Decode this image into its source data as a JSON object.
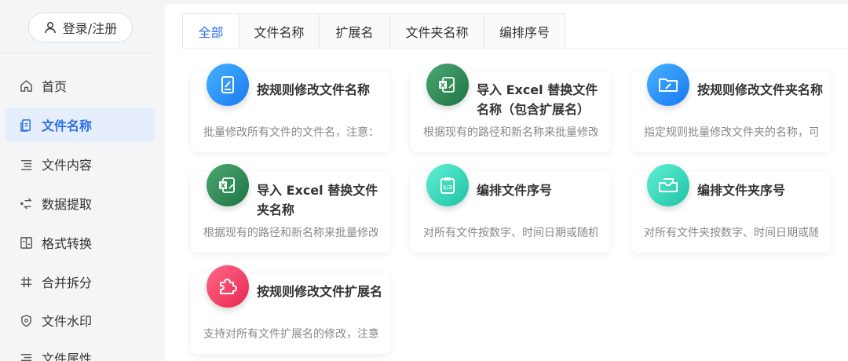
{
  "sidebar": {
    "login_label": "登录/注册",
    "items": [
      {
        "label": "首页",
        "icon": "home-icon"
      },
      {
        "label": "文件名称",
        "icon": "file-icon",
        "active": true
      },
      {
        "label": "文件内容",
        "icon": "list-icon"
      },
      {
        "label": "数据提取",
        "icon": "extract-icon"
      },
      {
        "label": "格式转换",
        "icon": "convert-icon"
      },
      {
        "label": "合并拆分",
        "icon": "hash-icon"
      },
      {
        "label": "文件水印",
        "icon": "shield-icon"
      },
      {
        "label": "文件属性",
        "icon": "list-icon"
      }
    ]
  },
  "tabs": [
    "全部",
    "文件名称",
    "扩展名",
    "文件夹名称",
    "编排序号"
  ],
  "active_tab": "全部",
  "cards": [
    {
      "title": "按规则修改文件名称",
      "desc": "批量修改所有文件的文件名，注意：i",
      "icon": "edit-file-icon",
      "color": "#2f8cf5"
    },
    {
      "title": "导入 Excel 替换文件名称（包含扩展名）",
      "desc": "根据现有的路径和新名称来批量修改,",
      "icon": "excel-icon",
      "color": "#2f8a55"
    },
    {
      "title": "按规则修改文件夹名称",
      "desc": "指定规则批量修改文件夹的名称，可以",
      "icon": "folder-edit-icon",
      "color": "#2f8cf5"
    },
    {
      "title": "导入 Excel 替换文件夹名称",
      "desc": "根据现有的路径和新名称来批量修改,",
      "icon": "excel-icon",
      "color": "#2f8a55"
    },
    {
      "title": "编排文件序号",
      "desc": "对所有文件按数字、时间日期或随机",
      "icon": "clipboard-icon",
      "color": "#2fd3b8"
    },
    {
      "title": "编排文件夹序号",
      "desc": "对所有文件夹按数字、时间日期或随机",
      "icon": "folder-tray-icon",
      "color": "#2fd3b8"
    },
    {
      "title": "按规则修改文件扩展名",
      "desc": "支持对所有文件扩展名的修改，注意:",
      "icon": "puzzle-icon",
      "color": "#f0416b"
    }
  ]
}
